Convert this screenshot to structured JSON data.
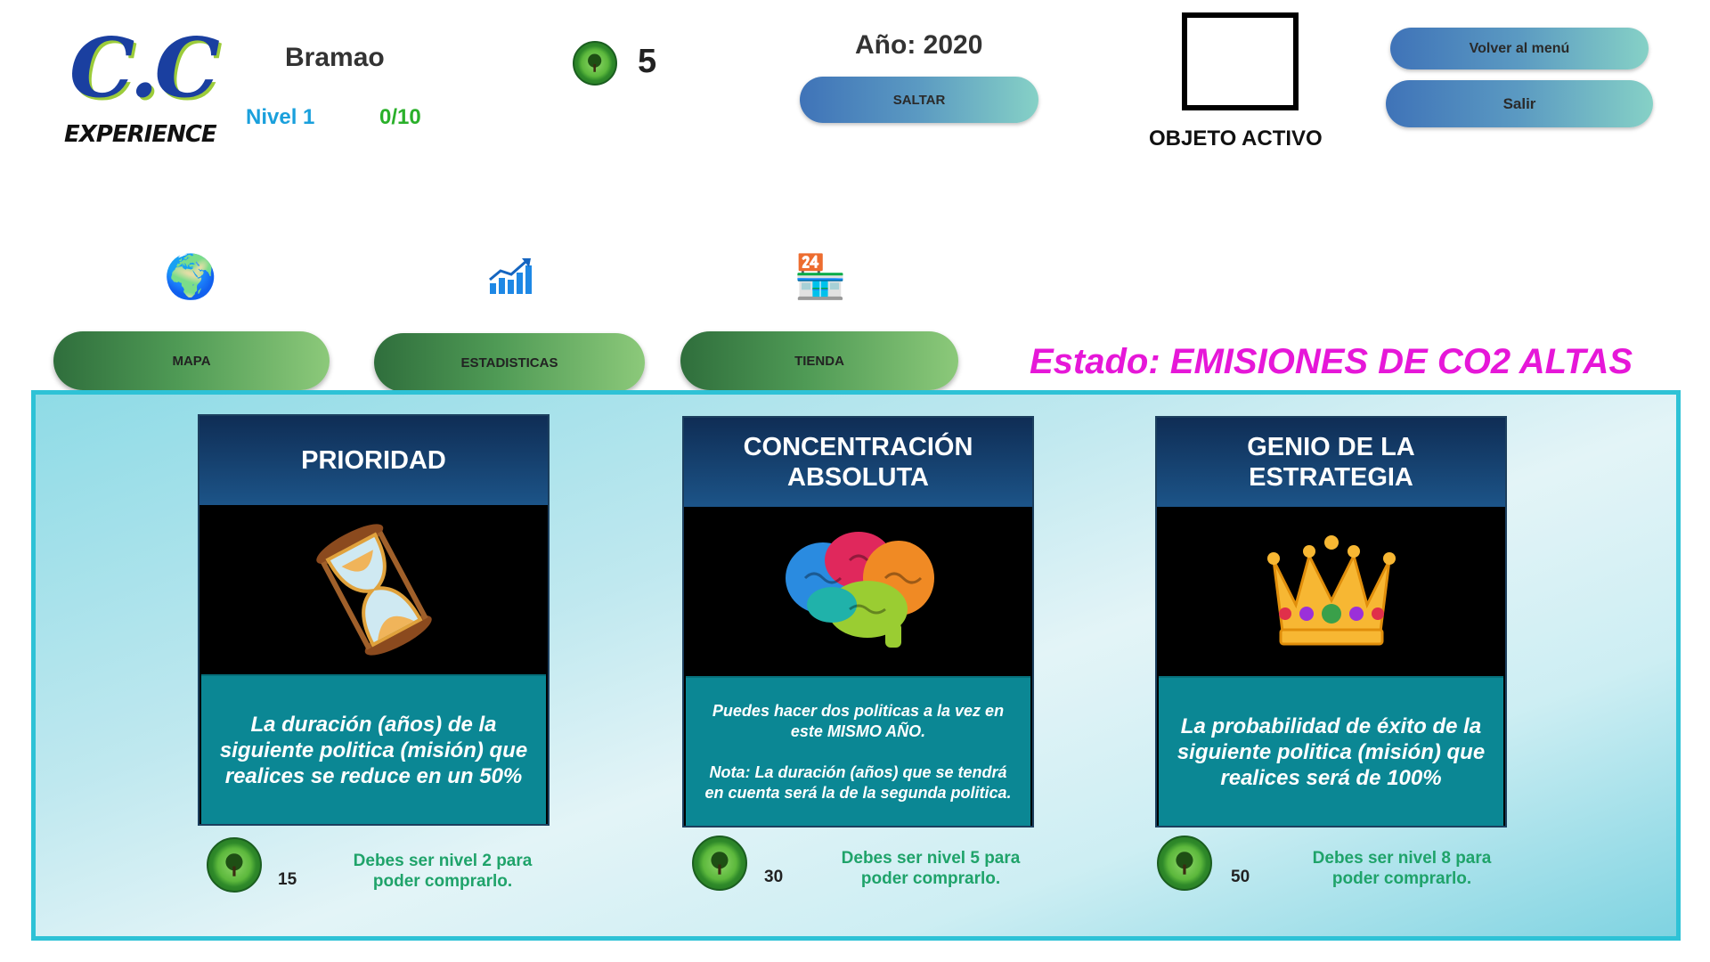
{
  "header": {
    "logo_title": "C.C",
    "logo_subtitle": "EXPERIENCE",
    "player_name": "Bramao",
    "level": "Nivel 1",
    "progress": "0/10",
    "coins": "5",
    "year": "Año: 2020",
    "skip_label": "SALTAR",
    "active_object_label": "OBJETO ACTIVO",
    "menu_label": "Volver al menú",
    "exit_label": "Salir"
  },
  "nav": {
    "map_label": "MAPA",
    "stats_label": "ESTADISTICAS",
    "shop_label": "TIENDA"
  },
  "status": "Estado: EMISIONES DE CO2 ALTAS",
  "colors": {
    "status": "#e617d8",
    "card_header": "#1c5488",
    "card_description": "#0b8794",
    "requirement_text": "#1fa36a"
  },
  "shop": {
    "cards": [
      {
        "title": "PRIORIDAD",
        "icon": "hourglass-icon",
        "description": "La duración (años) de la siguiente politica (misión) que realices se reduce en un 50%",
        "price": "15",
        "requirement": "Debes ser nivel 2 para poder comprarlo."
      },
      {
        "title": "CONCENTRACIÓN ABSOLUTA",
        "icon": "brain-icon",
        "description": "Puedes hacer dos politicas a la vez en este MISMO AÑO.\n\nNota: La duración (años) que se tendrá en cuenta será la de la segunda politica.",
        "price": "30",
        "requirement": "Debes ser nivel 5 para poder comprarlo."
      },
      {
        "title": "GENIO DE LA ESTRATEGIA",
        "icon": "crown-icon",
        "description": "La probabilidad de éxito de la siguiente politica (misión) que realices será de 100%",
        "price": "50",
        "requirement": "Debes ser nivel 8 para poder comprarlo."
      }
    ]
  }
}
